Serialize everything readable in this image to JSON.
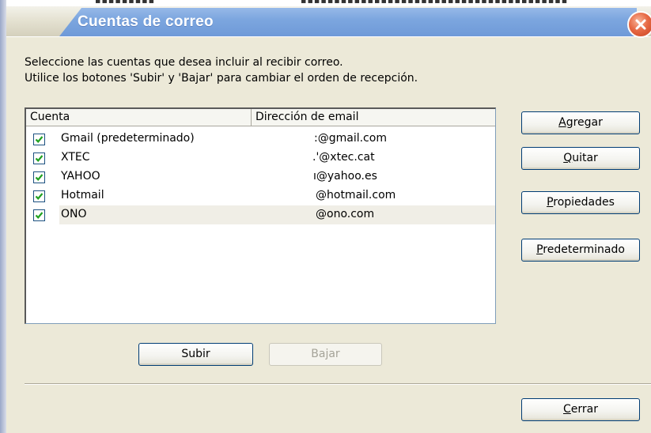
{
  "window": {
    "title": "Cuentas de correo"
  },
  "intro": {
    "line1": "Seleccione las cuentas que desea incluir al recibir correo.",
    "line2": "Utilice los botones 'Subir' y 'Bajar' para cambiar el orden de recepción."
  },
  "list": {
    "columns": [
      "Cuenta",
      "Dirección de email"
    ],
    "rows": [
      {
        "checked": true,
        "account": "Gmail (predeterminado)",
        "email": ":@gmail.com"
      },
      {
        "checked": true,
        "account": "XTEC",
        "email": ".'@xtec.cat"
      },
      {
        "checked": true,
        "account": "YAHOO",
        "email": "ı@yahoo.es"
      },
      {
        "checked": true,
        "account": "Hotmail",
        "email": "@hotmail.com"
      },
      {
        "checked": true,
        "account": "ONO",
        "email": "@ono.com",
        "selected": true
      }
    ]
  },
  "buttons": {
    "agregar": {
      "first": "A",
      "rest": "gregar"
    },
    "quitar": {
      "first": "Q",
      "rest": "uitar"
    },
    "propiedades": {
      "first": "P",
      "rest": "ropiedades"
    },
    "predeterminado": {
      "first": "P",
      "rest": "redeterminado"
    },
    "subir": "Subir",
    "bajar": "Bajar",
    "cerrar": {
      "first": "C",
      "rest": "errar"
    }
  },
  "colors": {
    "titlebar_blue": "#7ca6df",
    "dialog_bg": "#ece9d8",
    "checkbox_check": "#21a121",
    "close_red": "#e76a45"
  },
  "icons": {
    "close": "close-icon",
    "checkbox": "checkmark-icon"
  }
}
